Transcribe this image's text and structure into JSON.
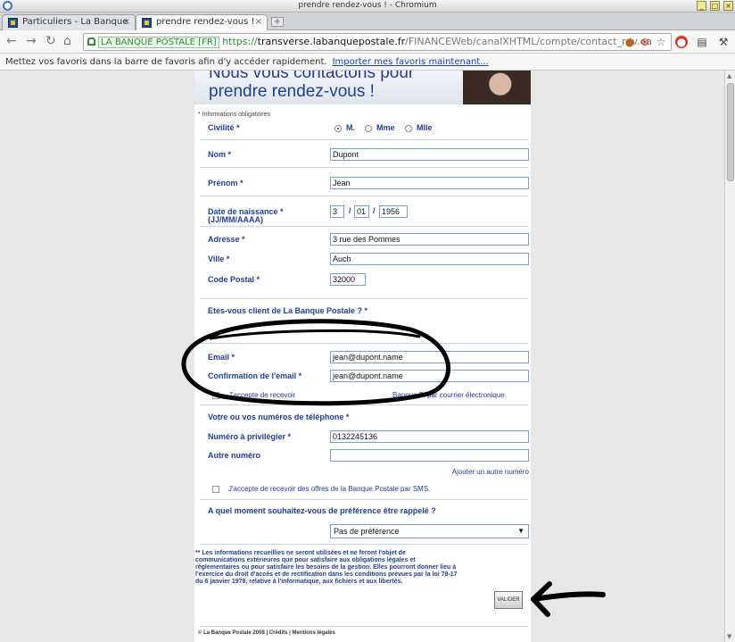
{
  "window": {
    "title": "prendre rendez-vous ! - Chromium"
  },
  "tabs": [
    {
      "label": "Particuliers - La Banque"
    },
    {
      "label": "prendre rendez-vous !"
    }
  ],
  "toolbar": {
    "ev_label": "LA BANQUE POSTALE [FR]",
    "url_proto": "https://",
    "url_host": "transverse.labanquepostale.fr",
    "url_path": "/FINANCEWeb/canalXHTML/compte/contact_rdv.ea"
  },
  "bookmarks": {
    "message": "Mettez vos favoris dans la barre de favoris afin d'y accéder rapidement.",
    "import_link": "Importer mes favoris maintenant..."
  },
  "page": {
    "heading_line1": "Nous vous contactons pour",
    "heading_line2": "prendre rendez-vous !",
    "required_note": "* Informations obligatoires",
    "civilite_label": "Civilité *",
    "civilite_options": [
      "M.",
      "Mme",
      "Mlle"
    ],
    "nom_label": "Nom *",
    "nom_value": "Dupont",
    "prenom_label": "Prénom *",
    "prenom_value": "Jean",
    "dob_label": "Date de naissance *",
    "dob_format": "(JJ/MM/AAAA)",
    "dob_day": "3",
    "dob_month": "01",
    "dob_year": "1956",
    "dob_sep": "/",
    "adresse_label": "Adresse *",
    "adresse_value": "3 rue des Pommes",
    "ville_label": "Ville *",
    "ville_value": "Auch",
    "cp_label": "Code Postal *",
    "cp_value": "32000",
    "client_question": "Etes-vous client de La Banque Postale ? *",
    "email_label": "Email *",
    "email_value": "jean@dupont.name",
    "email_confirm_label": "Confirmation de l'email *",
    "email_confirm_value": "jean@dupont.name",
    "email_optin_fragment_1": "J'accepte de recevoir",
    "email_optin_fragment_2": "Banque P",
    "email_optin_fragment_3": "par courrier électronique.",
    "phone_section": "Votre ou vos numéros de téléphone *",
    "phone_main_label": "Numéro à privilégier *",
    "phone_main_value": "0132245136",
    "phone_other_label": "Autre numéro",
    "phone_other_value": "",
    "add_number_link": "Ajouter un autre numéro",
    "sms_optin": "J'accepte de recevoir des offres de la Banque Postale par SMS.",
    "callback_question": "A quel moment souhaitez-vous de préférence être rappelé ?",
    "callback_value": "Pas de préférence",
    "legal_line1": "** Les informations recueillies ne seront utilisées et ne feront l'objet de",
    "legal_line2": "communications extérieures que pour satisfaire aux obligations légales et",
    "legal_line3": "réglementaires ou pour satisfaire les besoins de la gestion. Elles pourront donner lieu à",
    "legal_line4": "l'exercice du droit d'accès et de rectification dans les conditions prévues par la loi 78-17",
    "legal_line5": "du 6 janvier 1978, relative à l'informatique, aux fichiers et aux libertés.",
    "submit_label": "VALIDER",
    "footer": "© La Banque Postale 2008 | Crédits | Mentions légales"
  },
  "colors": {
    "brand_blue": "#1f3e97",
    "field_border": "#7aa0c8",
    "ssl_green": "#2e8b2e"
  }
}
